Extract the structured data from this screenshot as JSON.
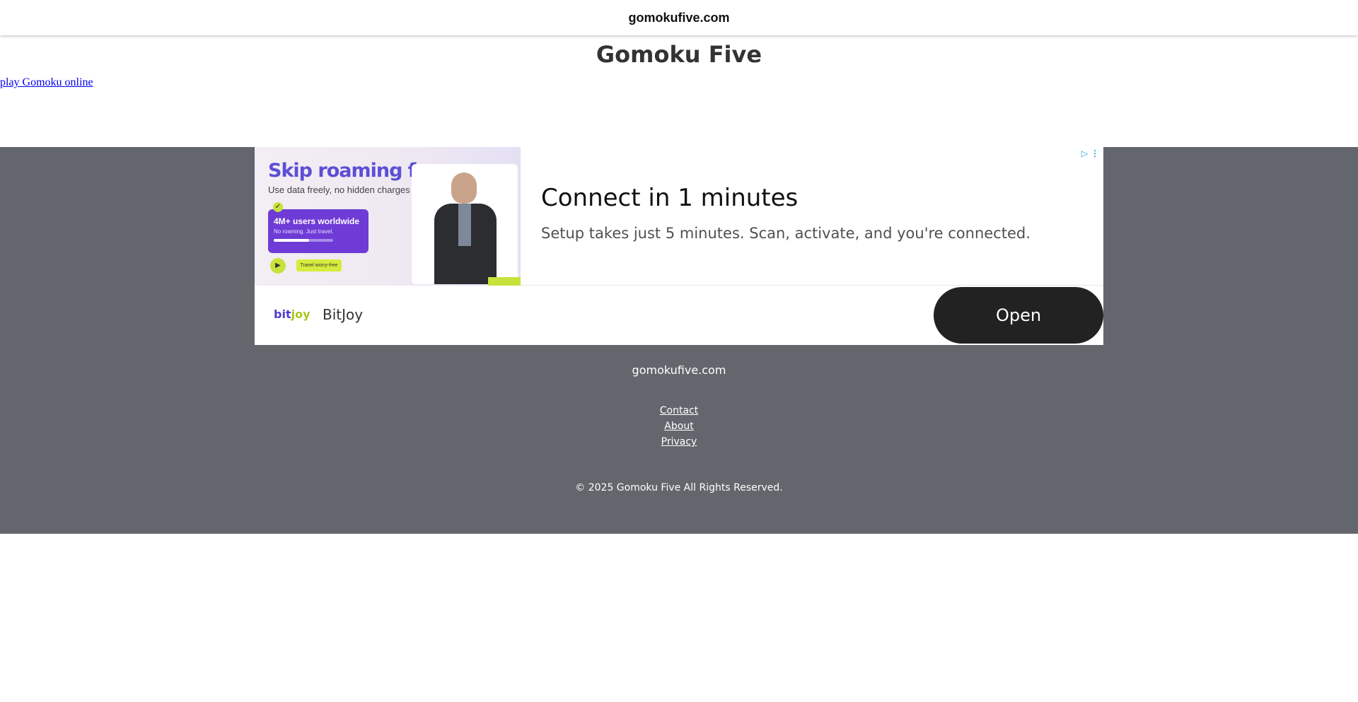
{
  "header": {
    "domain": "gomokufive.com"
  },
  "main": {
    "title": "Gomoku Five",
    "play_link": "play Gomoku online"
  },
  "ad": {
    "image": {
      "headline": "Skip roaming fees",
      "subline": "Use data freely, no hidden charges",
      "card_title": "4M+ users worldwide",
      "card_sub": "No roaming. Just travel.",
      "card_progress": 0.6,
      "pill": "Travel worry-free"
    },
    "title": "Connect in 1 minutes",
    "description": "Setup takes just 5 minutes. Scan, activate, and you're connected.",
    "brand_logo": {
      "part1": "bit",
      "part2": "joy"
    },
    "brand_name": "BitJoy",
    "cta": "Open",
    "colors": {
      "cta_bg": "#222222",
      "adchoices": "#1ea1d8"
    }
  },
  "footer": {
    "domain": "gomokufive.com",
    "links": [
      "Contact",
      "About",
      "Privacy"
    ],
    "copyright": "© 2025 Gomoku Five All Rights Reserved.",
    "background": "#63666c"
  }
}
